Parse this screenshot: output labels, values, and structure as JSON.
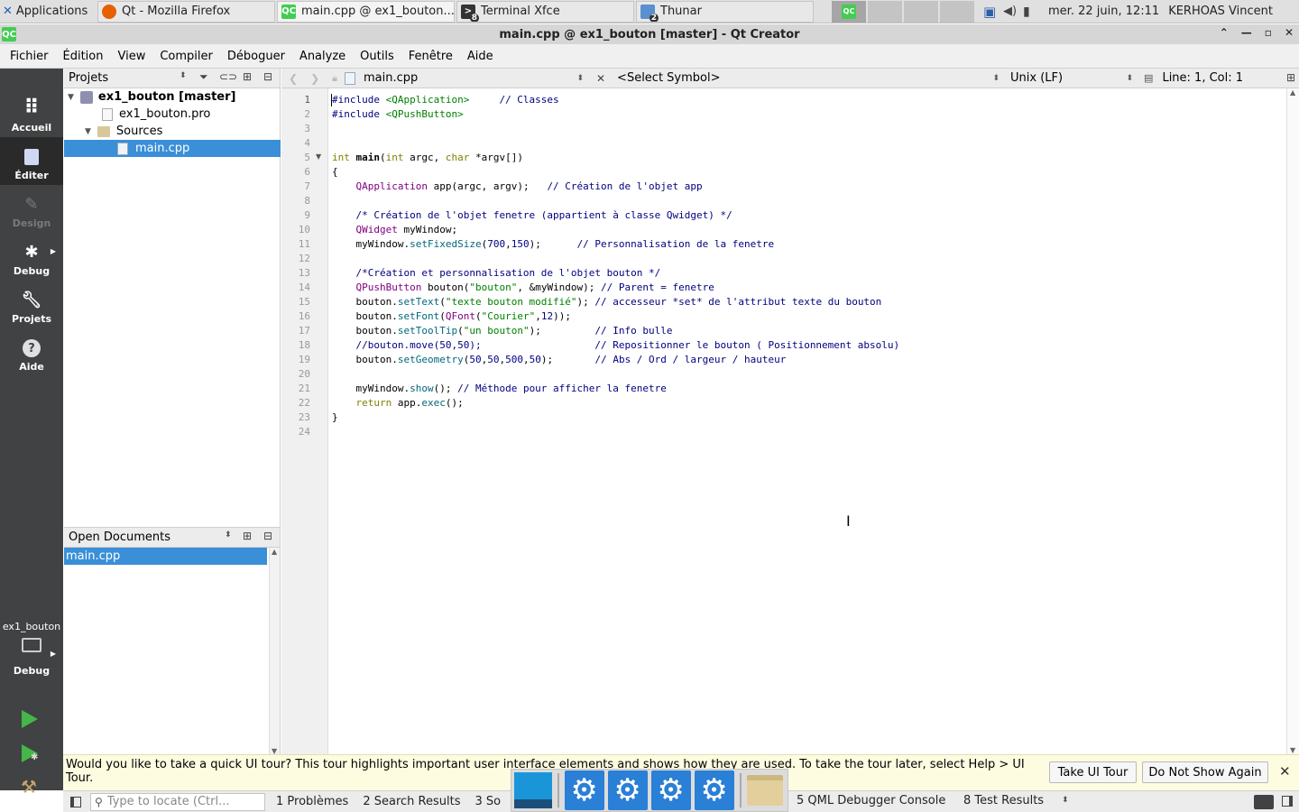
{
  "panel": {
    "apps_label": "Applications",
    "tasks": [
      {
        "label": "Qt - Mozilla Firefox"
      },
      {
        "label": "main.cpp @ ex1_bouton..."
      },
      {
        "label": "Terminal Xfce",
        "badge": "8"
      },
      {
        "label": "Thunar",
        "badge": "2"
      }
    ],
    "clock": "mer. 22 juin, 12:11",
    "user": "KERHOAS Vincent"
  },
  "window": {
    "title": "main.cpp @ ex1_bouton [master] - Qt Creator",
    "app_icon": "QC"
  },
  "menus": [
    "Fichier",
    "Édition",
    "View",
    "Compiler",
    "Déboguer",
    "Analyze",
    "Outils",
    "Fenêtre",
    "Aide"
  ],
  "modes": [
    {
      "label": "Accueil",
      "icon": "grid-icon"
    },
    {
      "label": "Éditer",
      "icon": "edit-icon"
    },
    {
      "label": "Design",
      "icon": "pencil-icon"
    },
    {
      "label": "Debug",
      "icon": "bug-icon"
    },
    {
      "label": "Projets",
      "icon": "wrench-icon"
    },
    {
      "label": "Aide",
      "icon": "help-icon"
    }
  ],
  "kit": {
    "project": "ex1_bouton",
    "config": "Debug"
  },
  "projects": {
    "header": "Projets",
    "tree": [
      {
        "label": "ex1_bouton [master]"
      },
      {
        "label": "ex1_bouton.pro"
      },
      {
        "label": "Sources"
      },
      {
        "label": "main.cpp"
      }
    ]
  },
  "open_docs": {
    "header": "Open Documents",
    "items": [
      "main.cpp"
    ]
  },
  "editor": {
    "file": "main.cpp",
    "symbol": "<Select Symbol>",
    "line_ending": "Unix (LF)",
    "position": "Line: 1, Col: 1",
    "lines": [
      "#include <QApplication>     // Classes",
      "#include <QPushButton>",
      "",
      "",
      "int main(int argc, char *argv[])",
      "{",
      "    QApplication app(argc, argv);   // Création de l'objet app",
      "",
      "    /* Création de l'objet fenetre (appartient à classe Qwidget) */",
      "    QWidget myWindow;",
      "    myWindow.setFixedSize(700,150);      // Personnalisation de la fenetre",
      "",
      "    /*Création et personnalisation de l'objet bouton */",
      "    QPushButton bouton(\"bouton\", &myWindow); // Parent = fenetre",
      "    bouton.setText(\"texte bouton modifié\"); // accesseur *set* de l'attribut texte du bouton",
      "    bouton.setFont(QFont(\"Courier\",12));",
      "    bouton.setToolTip(\"un bouton\");         // Info bulle",
      "    //bouton.move(50,50);                   // Repositionner le bouton ( Positionnement absolu)",
      "    bouton.setGeometry(50,50,500,50);       // Abs / Ord / largeur / hauteur",
      "",
      "    myWindow.show(); // Méthode pour afficher la fenetre",
      "    return app.exec();",
      "}",
      ""
    ]
  },
  "tour": {
    "message": "Would you like to take a quick UI tour? This tour highlights important user interface elements and shows how they are used. To take the tour later, select Help > UI Tour.",
    "take_label": "Take UI Tour",
    "dismiss_label": "Do Not Show Again"
  },
  "statusbar": {
    "locate_placeholder": "Type to locate (Ctrl...",
    "tabs": [
      "1  Problèmes",
      "2  Search Results",
      "3  So",
      "5  QML Debugger Console",
      "8  Test Results"
    ]
  }
}
